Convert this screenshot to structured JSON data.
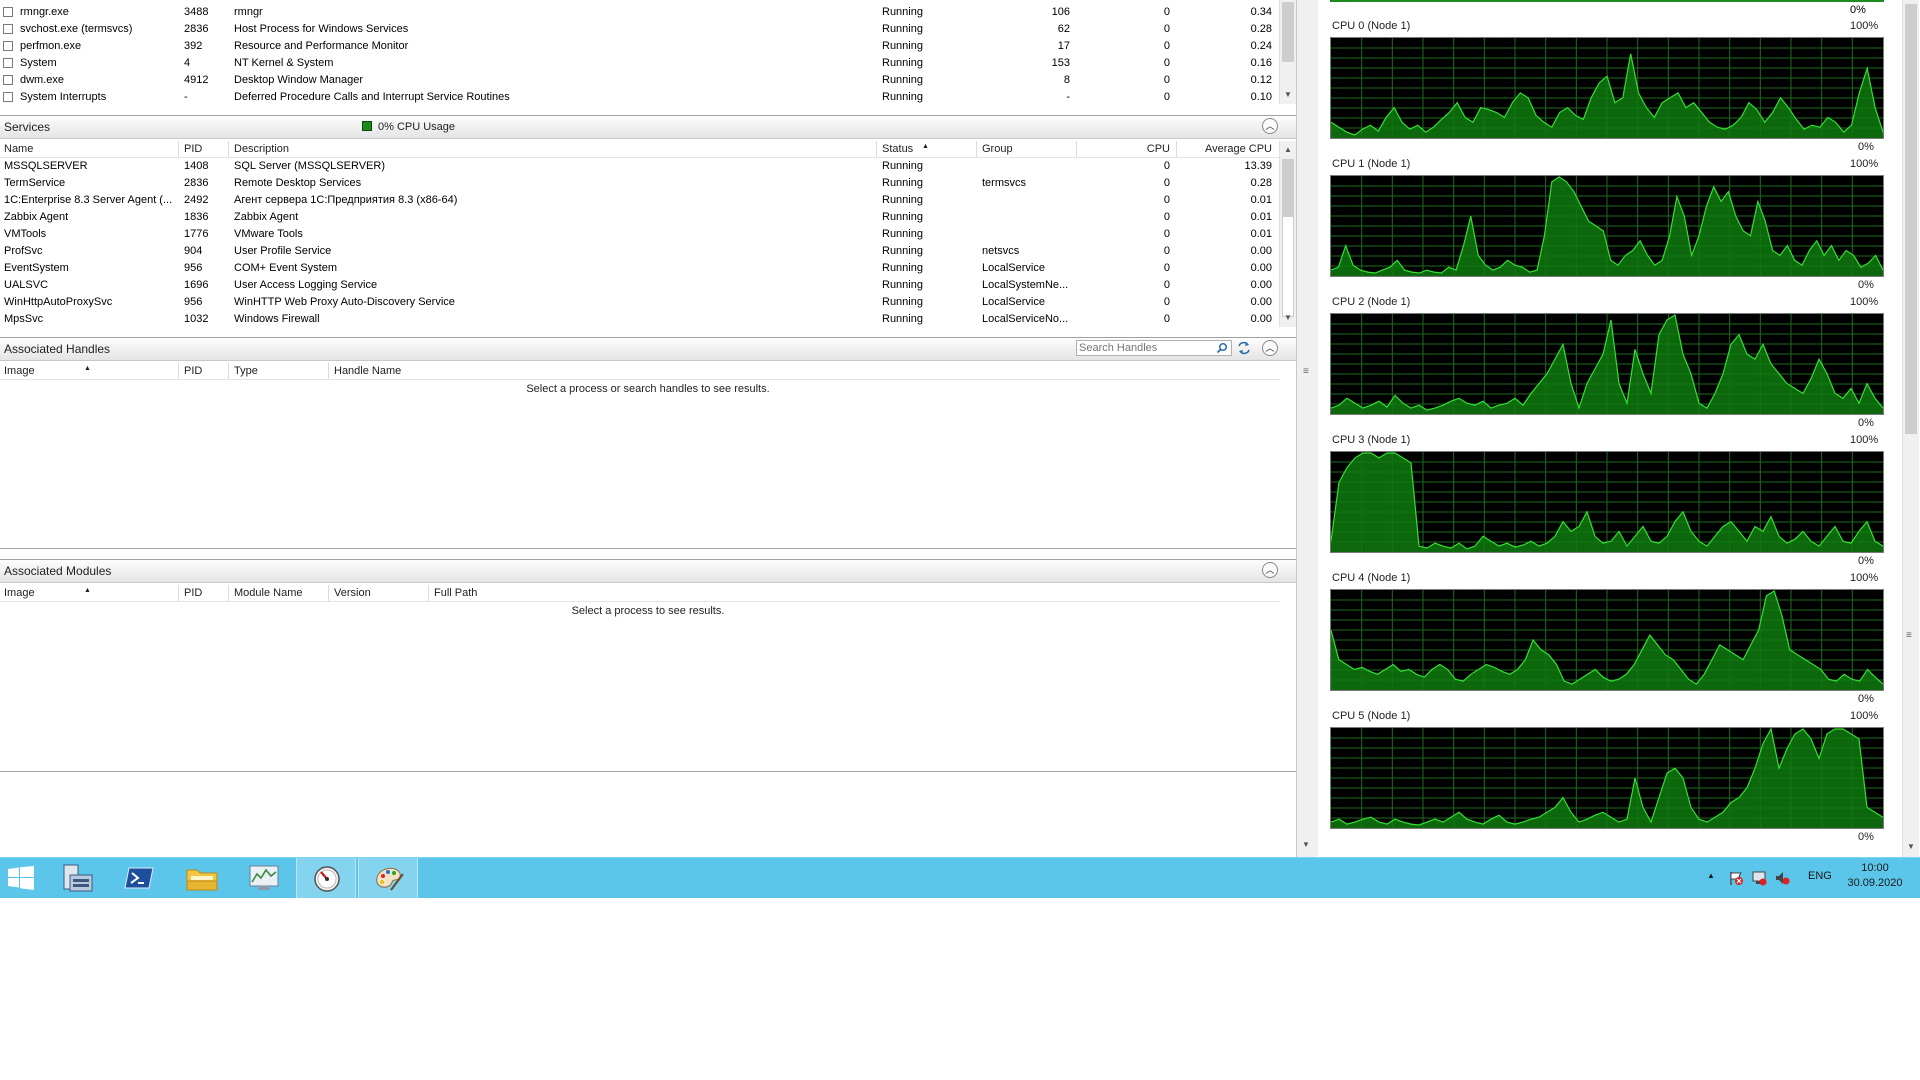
{
  "processes": {
    "rows": [
      {
        "image": "rmngr.exe",
        "pid": "3488",
        "description": "rmngr",
        "status": "Running",
        "threads": "106",
        "cpu": "0",
        "avg_cpu": "0.34"
      },
      {
        "image": "svchost.exe (termsvcs)",
        "pid": "2836",
        "description": "Host Process for Windows Services",
        "status": "Running",
        "threads": "62",
        "cpu": "0",
        "avg_cpu": "0.28"
      },
      {
        "image": "perfmon.exe",
        "pid": "392",
        "description": "Resource and Performance Monitor",
        "status": "Running",
        "threads": "17",
        "cpu": "0",
        "avg_cpu": "0.24"
      },
      {
        "image": "System",
        "pid": "4",
        "description": "NT Kernel & System",
        "status": "Running",
        "threads": "153",
        "cpu": "0",
        "avg_cpu": "0.16"
      },
      {
        "image": "dwm.exe",
        "pid": "4912",
        "description": "Desktop Window Manager",
        "status": "Running",
        "threads": "8",
        "cpu": "0",
        "avg_cpu": "0.12"
      },
      {
        "image": "System Interrupts",
        "pid": "-",
        "description": "Deferred Procedure Calls and Interrupt Service Routines",
        "status": "Running",
        "threads": "-",
        "cpu": "0",
        "avg_cpu": "0.10"
      }
    ]
  },
  "services": {
    "title": "Services",
    "badge": "0% CPU Usage",
    "badge_color": "#1a8a1a",
    "columns": {
      "name": "Name",
      "pid": "PID",
      "description": "Description",
      "status": "Status",
      "group": "Group",
      "cpu": "CPU",
      "avg_cpu": "Average CPU"
    },
    "rows": [
      {
        "name": "MSSQLSERVER",
        "pid": "1408",
        "description": "SQL Server (MSSQLSERVER)",
        "status": "Running",
        "group": "",
        "cpu": "0",
        "avg_cpu": "13.39"
      },
      {
        "name": "TermService",
        "pid": "2836",
        "description": "Remote Desktop Services",
        "status": "Running",
        "group": "termsvcs",
        "cpu": "0",
        "avg_cpu": "0.28"
      },
      {
        "name": "1C:Enterprise 8.3 Server Agent (...",
        "pid": "2492",
        "description": "Агент сервера 1С:Предприятия 8.3 (x86-64)",
        "status": "Running",
        "group": "",
        "cpu": "0",
        "avg_cpu": "0.01"
      },
      {
        "name": "Zabbix Agent",
        "pid": "1836",
        "description": "Zabbix Agent",
        "status": "Running",
        "group": "",
        "cpu": "0",
        "avg_cpu": "0.01"
      },
      {
        "name": "VMTools",
        "pid": "1776",
        "description": "VMware Tools",
        "status": "Running",
        "group": "",
        "cpu": "0",
        "avg_cpu": "0.01"
      },
      {
        "name": "ProfSvc",
        "pid": "904",
        "description": "User Profile Service",
        "status": "Running",
        "group": "netsvcs",
        "cpu": "0",
        "avg_cpu": "0.00"
      },
      {
        "name": "EventSystem",
        "pid": "956",
        "description": "COM+ Event System",
        "status": "Running",
        "group": "LocalService",
        "cpu": "0",
        "avg_cpu": "0.00"
      },
      {
        "name": "UALSVC",
        "pid": "1696",
        "description": "User Access Logging Service",
        "status": "Running",
        "group": "LocalSystemNe...",
        "cpu": "0",
        "avg_cpu": "0.00"
      },
      {
        "name": "WinHttpAutoProxySvc",
        "pid": "956",
        "description": "WinHTTP Web Proxy Auto-Discovery Service",
        "status": "Running",
        "group": "LocalService",
        "cpu": "0",
        "avg_cpu": "0.00"
      },
      {
        "name": "MpsSvc",
        "pid": "1032",
        "description": "Windows Firewall",
        "status": "Running",
        "group": "LocalServiceNo...",
        "cpu": "0",
        "avg_cpu": "0.00"
      }
    ]
  },
  "handles": {
    "title": "Associated Handles",
    "search_placeholder": "Search Handles",
    "columns": {
      "image": "Image",
      "pid": "PID",
      "type": "Type",
      "handle_name": "Handle Name"
    },
    "empty_message": "Select a process or search handles to see results."
  },
  "modules": {
    "title": "Associated Modules",
    "columns": {
      "image": "Image",
      "pid": "PID",
      "module_name": "Module Name",
      "version": "Version",
      "full_path": "Full Path"
    },
    "empty_message": "Select a process to see results."
  },
  "cpu_graphs": {
    "max_label": "100%",
    "min_label": "0%",
    "line_color": "#33e033",
    "fill_color": "#0f7a0f",
    "grid_color": "#1f6b1f",
    "items": [
      {
        "label": "CPU 0 (Node 1)",
        "values": [
          15,
          10,
          5,
          2,
          8,
          12,
          6,
          20,
          30,
          15,
          8,
          12,
          5,
          10,
          18,
          25,
          35,
          20,
          15,
          30,
          28,
          25,
          20,
          35,
          45,
          40,
          22,
          15,
          10,
          25,
          30,
          22,
          18,
          40,
          55,
          62,
          35,
          40,
          85,
          45,
          30,
          20,
          35,
          40,
          45,
          30,
          35,
          25,
          15,
          10,
          8,
          12,
          20,
          35,
          28,
          15,
          25,
          40,
          30,
          18,
          8,
          12,
          10,
          20,
          15,
          5,
          12,
          45,
          70,
          30,
          5
        ]
      },
      {
        "label": "CPU 1 (Node 1)",
        "values": [
          5,
          8,
          30,
          10,
          5,
          3,
          2,
          5,
          8,
          15,
          5,
          3,
          2,
          5,
          3,
          2,
          8,
          5,
          30,
          60,
          20,
          10,
          5,
          8,
          15,
          10,
          8,
          3,
          5,
          40,
          95,
          100,
          95,
          85,
          70,
          55,
          50,
          45,
          15,
          10,
          20,
          25,
          35,
          20,
          10,
          15,
          40,
          80,
          60,
          20,
          40,
          70,
          90,
          75,
          85,
          60,
          45,
          40,
          75,
          55,
          25,
          20,
          30,
          15,
          10,
          25,
          35,
          20,
          30,
          15,
          25,
          20,
          8,
          12,
          20,
          5
        ]
      },
      {
        "label": "CPU 2 (Node 1)",
        "values": [
          5,
          8,
          15,
          10,
          5,
          8,
          12,
          6,
          18,
          10,
          5,
          8,
          3,
          5,
          8,
          12,
          15,
          10,
          8,
          12,
          5,
          8,
          10,
          15,
          8,
          20,
          30,
          40,
          55,
          70,
          30,
          5,
          30,
          45,
          60,
          95,
          30,
          10,
          65,
          40,
          20,
          80,
          95,
          100,
          60,
          40,
          10,
          5,
          20,
          40,
          70,
          80,
          60,
          55,
          70,
          50,
          40,
          30,
          25,
          20,
          35,
          55,
          40,
          20,
          15,
          25,
          10,
          30,
          15,
          5
        ]
      },
      {
        "label": "CPU 3 (Node 1)",
        "values": [
          10,
          70,
          85,
          95,
          100,
          100,
          95,
          100,
          100,
          95,
          90,
          5,
          3,
          8,
          5,
          3,
          8,
          2,
          5,
          15,
          10,
          5,
          8,
          4,
          6,
          10,
          5,
          8,
          15,
          30,
          20,
          25,
          40,
          15,
          8,
          10,
          20,
          5,
          15,
          25,
          10,
          8,
          15,
          30,
          40,
          20,
          10,
          5,
          15,
          25,
          30,
          20,
          10,
          25,
          20,
          35,
          15,
          8,
          12,
          20,
          10,
          5,
          15,
          25,
          10,
          8,
          20,
          30,
          10,
          5
        ]
      },
      {
        "label": "CPU 4 (Node 1)",
        "values": [
          60,
          30,
          25,
          20,
          22,
          18,
          15,
          20,
          25,
          18,
          20,
          15,
          12,
          20,
          25,
          20,
          10,
          8,
          15,
          20,
          25,
          22,
          18,
          15,
          20,
          30,
          50,
          40,
          35,
          25,
          8,
          5,
          10,
          15,
          20,
          12,
          8,
          10,
          15,
          25,
          40,
          55,
          45,
          35,
          30,
          20,
          10,
          5,
          15,
          30,
          45,
          40,
          35,
          30,
          45,
          60,
          95,
          100,
          75,
          40,
          35,
          30,
          25,
          20,
          10,
          8,
          15,
          10,
          8,
          20,
          12,
          5
        ]
      },
      {
        "label": "CPU 5 (Node 1)",
        "values": [
          5,
          8,
          3,
          5,
          8,
          10,
          5,
          3,
          8,
          5,
          3,
          2,
          5,
          8,
          5,
          10,
          15,
          8,
          5,
          3,
          8,
          12,
          5,
          3,
          5,
          8,
          10,
          15,
          20,
          30,
          15,
          5,
          8,
          12,
          15,
          10,
          5,
          8,
          50,
          20,
          5,
          30,
          55,
          60,
          50,
          20,
          8,
          5,
          10,
          15,
          25,
          30,
          40,
          60,
          85,
          100,
          60,
          80,
          95,
          100,
          90,
          70,
          95,
          100,
          100,
          95,
          90,
          20,
          15,
          10
        ]
      }
    ]
  },
  "taskbar": {
    "apps": [
      {
        "name": "Server Manager"
      },
      {
        "name": "Windows PowerShell"
      },
      {
        "name": "File Explorer"
      },
      {
        "name": "Performance Monitor"
      },
      {
        "name": "Resource Monitor"
      },
      {
        "name": "Paint"
      }
    ],
    "language": "ENG",
    "time": "10:00",
    "date": "30.09.2020"
  }
}
